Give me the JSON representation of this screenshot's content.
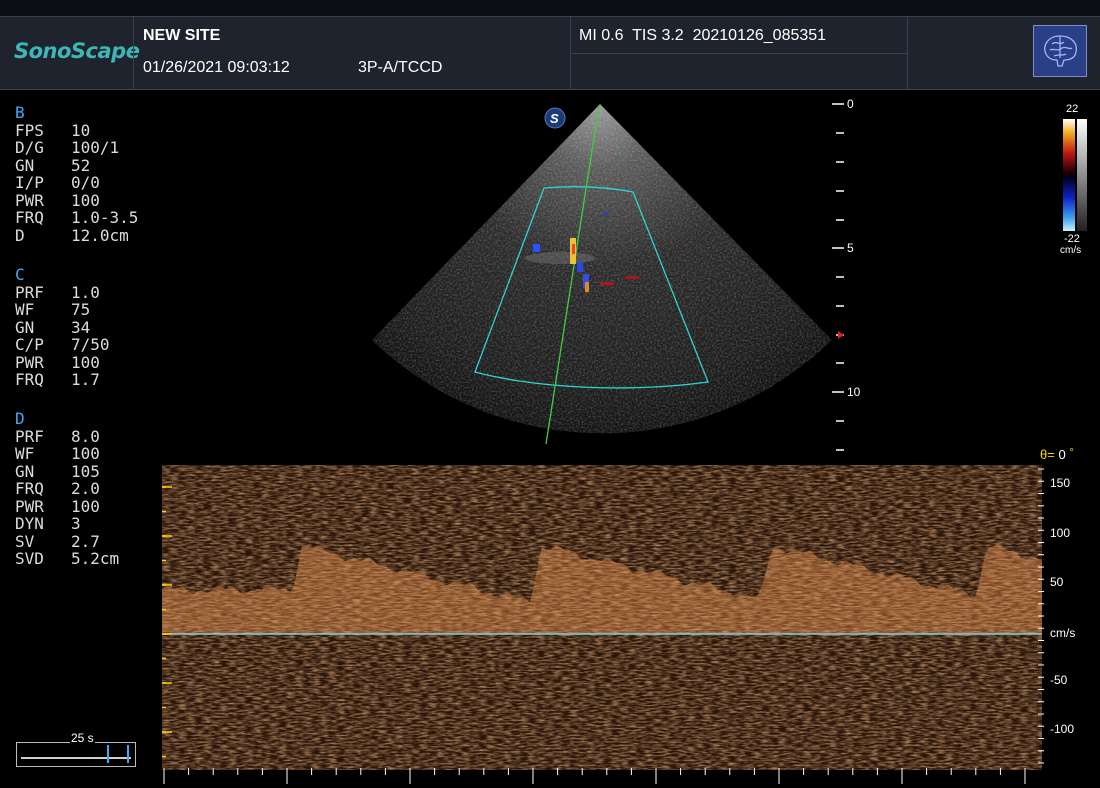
{
  "header": {
    "brand": "SonoScape",
    "site": "NEW SITE",
    "datetime": "01/26/2021 09:03:12",
    "probe_preset": "3P-A/TCCD",
    "mi_label": "MI",
    "mi_value": "0.6",
    "tis_label": "TIS",
    "tis_value": "3.2",
    "image_id": "20210126_085351",
    "preset_icon": "brain-icon"
  },
  "params": {
    "b": {
      "title": "B",
      "rows": [
        {
          "k": "FPS",
          "v": "10"
        },
        {
          "k": "D/G",
          "v": "100/1"
        },
        {
          "k": "GN",
          "v": "52"
        },
        {
          "k": "I/P",
          "v": "0/0"
        },
        {
          "k": "PWR",
          "v": "100"
        },
        {
          "k": "FRQ",
          "v": "1.0-3.5"
        },
        {
          "k": "D",
          "v": "12.0cm"
        }
      ]
    },
    "c": {
      "title": "C",
      "rows": [
        {
          "k": "PRF",
          "v": "1.0"
        },
        {
          "k": "WF",
          "v": "75"
        },
        {
          "k": "GN",
          "v": "34"
        },
        {
          "k": "C/P",
          "v": "7/50"
        },
        {
          "k": "PWR",
          "v": "100"
        },
        {
          "k": "FRQ",
          "v": "1.7"
        }
      ]
    },
    "d": {
      "title": "D",
      "rows": [
        {
          "k": "PRF",
          "v": "8.0"
        },
        {
          "k": "WF",
          "v": "100"
        },
        {
          "k": "GN",
          "v": "105"
        },
        {
          "k": "FRQ",
          "v": "2.0"
        },
        {
          "k": "PWR",
          "v": "100"
        },
        {
          "k": "DYN",
          "v": "3"
        },
        {
          "k": "SV",
          "v": "2.7"
        },
        {
          "k": "SVD",
          "v": "5.2cm"
        }
      ]
    }
  },
  "depth_scale": {
    "labels": [
      "0",
      "5",
      "10"
    ]
  },
  "color_bar": {
    "max": "22",
    "min": "-22",
    "unit": "cm/s"
  },
  "doppler": {
    "angle_symbol": "θ=",
    "angle_value": "0",
    "angle_unit": "°",
    "velocity_labels": [
      "150",
      "100",
      "50",
      "-50",
      "-100"
    ],
    "velocity_unit": "cm/s"
  },
  "timebar": {
    "label": "25 s"
  },
  "colors": {
    "accent_cyan": "#3fb5b5",
    "section_blue": "#3fa9f5",
    "angle_yellow": "#ffd400",
    "doppler_orange": "#c0733a",
    "roi_cyan": "#2fd3d3",
    "cursor_green": "#3fcf3f"
  }
}
